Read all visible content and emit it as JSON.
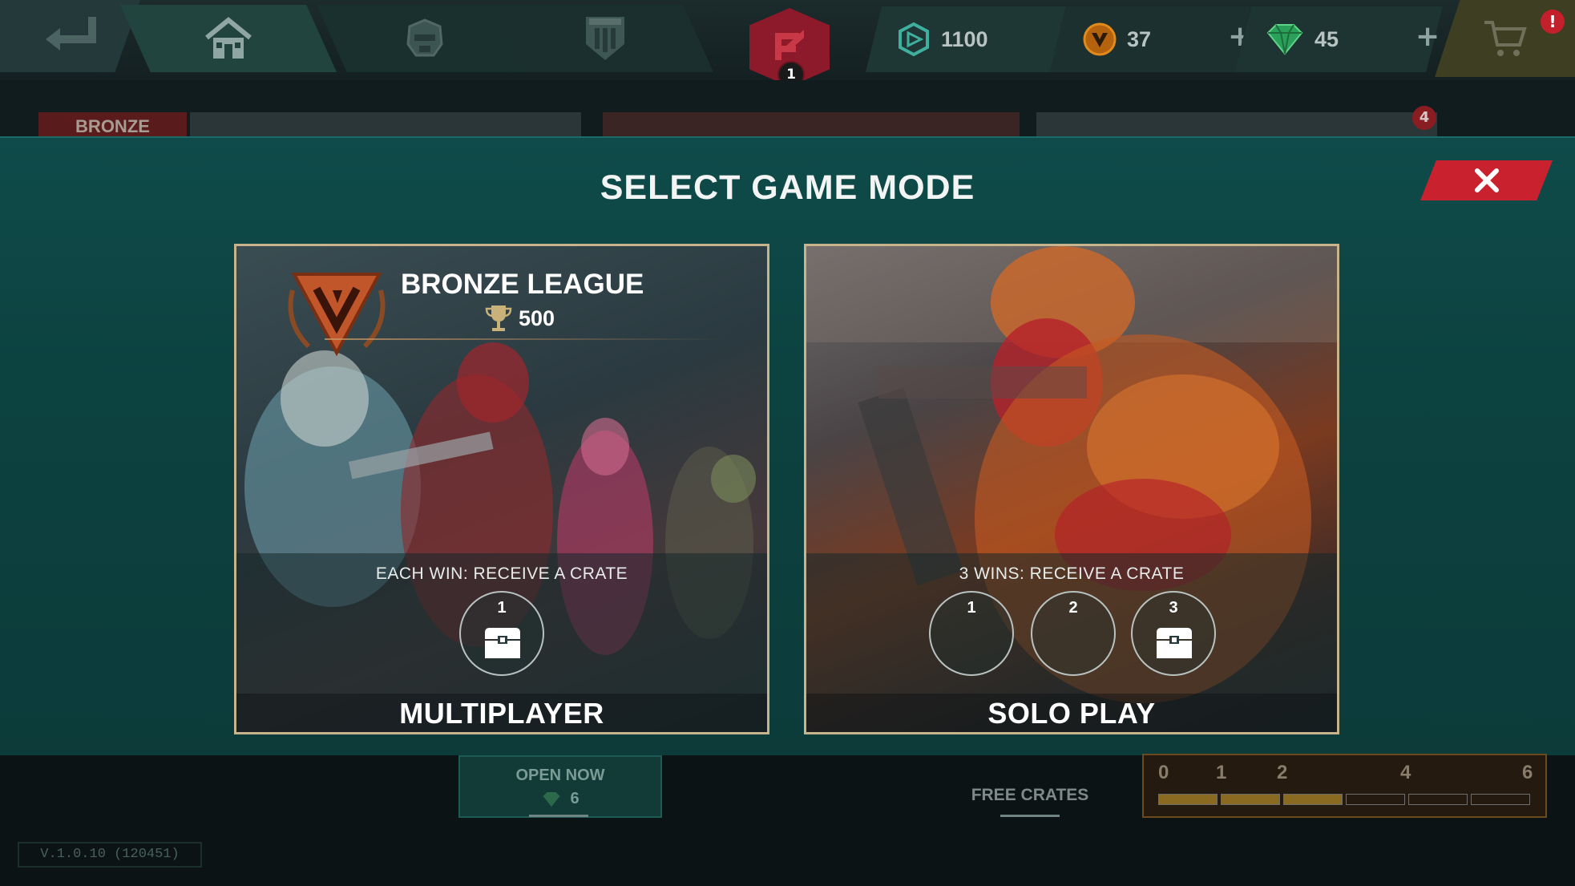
{
  "topbar": {
    "rank_level": "1",
    "currencies": [
      {
        "icon": "credits-icon",
        "value": "1100"
      },
      {
        "icon": "gold-coin-icon",
        "value": "37"
      },
      {
        "icon": "gem-icon",
        "value": "45"
      }
    ],
    "shop_alert": "!"
  },
  "background": {
    "league_tag": "BRONZE",
    "notification_count": "4"
  },
  "modal": {
    "title": "SELECT GAME MODE",
    "modes": [
      {
        "name": "MULTIPLAYER",
        "league": {
          "name": "BRONZE LEAGUE",
          "trophies": "500"
        },
        "reward_text": "EACH WIN: RECEIVE A CRATE",
        "slots": [
          {
            "num": "1",
            "has_crate": true
          }
        ]
      },
      {
        "name": "SOLO PLAY",
        "reward_text": "3 WINS: RECEIVE A CRATE",
        "slots": [
          {
            "num": "1",
            "has_crate": false
          },
          {
            "num": "2",
            "has_crate": false
          },
          {
            "num": "3",
            "has_crate": true
          }
        ]
      }
    ]
  },
  "bottom": {
    "open_now_label": "OPEN NOW",
    "open_now_count": "6",
    "free_crates_label": "FREE CRATES",
    "progress_ticks": [
      "0",
      "1",
      "2",
      "4",
      "6"
    ],
    "version": "V.1.0.10 (120451)"
  },
  "colors": {
    "modal_bg": "#0f4b4a",
    "close_red": "#c9222e",
    "card_border": "#c7b48c",
    "bronze": "#c0562a"
  }
}
